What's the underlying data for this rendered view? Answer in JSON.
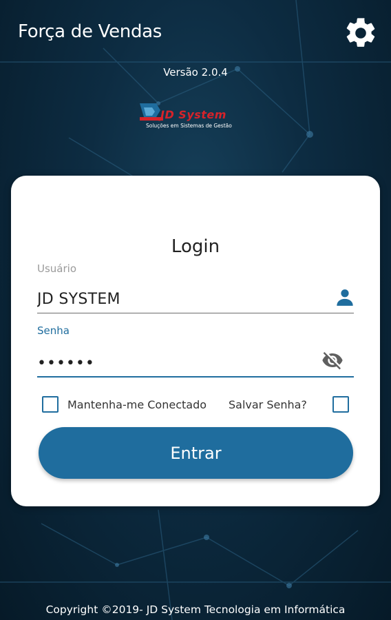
{
  "header": {
    "title": "Força de Vendas",
    "settings_icon": "gear-icon"
  },
  "version": "Versão 2.0.4",
  "logo": {
    "wordmark": "JD System",
    "tagline": "Soluções em Sistemas de Gestão",
    "colors": {
      "wordmark": "#d6232a",
      "mark": "#1f6d9e"
    }
  },
  "login": {
    "title": "Login",
    "username": {
      "label": "Usuário",
      "value": "JD SYSTEM",
      "icon": "user-icon"
    },
    "password": {
      "label": "Senha",
      "value": "••••••",
      "icon": "eye-off-icon"
    },
    "keep_connected": {
      "label": "Mantenha-me Conectado",
      "checked": false
    },
    "save_password": {
      "label": "Salvar Senha?",
      "checked": false
    },
    "submit_label": "Entrar"
  },
  "footer": {
    "copyright": "Copyright ©2019- JD System Tecnologia em Informática"
  },
  "theme": {
    "accent": "#1f6d9e",
    "background": "#0d2c42",
    "card": "#ffffff"
  }
}
